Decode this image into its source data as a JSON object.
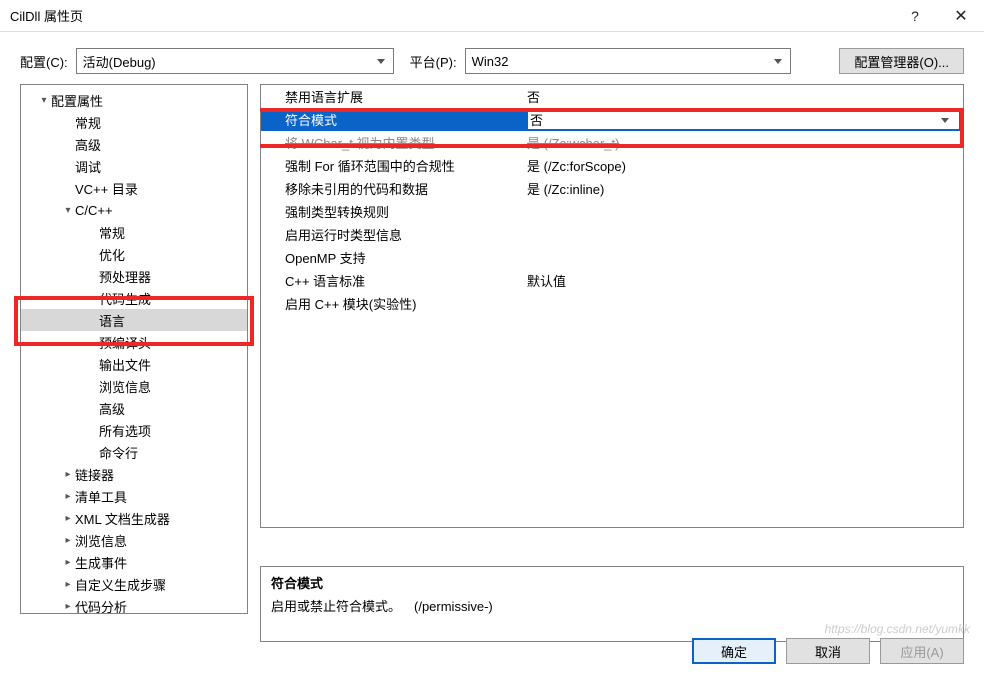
{
  "window": {
    "title": "CilDll 属性页",
    "help": "?",
    "close": "✕"
  },
  "toolbar": {
    "cfg_label": "配置(C):",
    "cfg_value": "活动(Debug)",
    "plat_label": "平台(P):",
    "plat_value": "Win32",
    "mgr": "配置管理器(O)..."
  },
  "tree": [
    {
      "lvl": 1,
      "exp": "▾",
      "label": "配置属性"
    },
    {
      "lvl": 2,
      "exp": "",
      "label": "常规"
    },
    {
      "lvl": 2,
      "exp": "",
      "label": "高级"
    },
    {
      "lvl": 2,
      "exp": "",
      "label": "调试"
    },
    {
      "lvl": 2,
      "exp": "",
      "label": "VC++ 目录"
    },
    {
      "lvl": 2,
      "exp": "▾",
      "label": "C/C++"
    },
    {
      "lvl": 3,
      "exp": "",
      "label": "常规"
    },
    {
      "lvl": 3,
      "exp": "",
      "label": "优化"
    },
    {
      "lvl": 3,
      "exp": "",
      "label": "预处理器"
    },
    {
      "lvl": 3,
      "exp": "",
      "label": "代码生成"
    },
    {
      "lvl": 3,
      "exp": "",
      "label": "语言",
      "sel": true
    },
    {
      "lvl": 3,
      "exp": "",
      "label": "预编译头"
    },
    {
      "lvl": 3,
      "exp": "",
      "label": "输出文件"
    },
    {
      "lvl": 3,
      "exp": "",
      "label": "浏览信息"
    },
    {
      "lvl": 3,
      "exp": "",
      "label": "高级"
    },
    {
      "lvl": 3,
      "exp": "",
      "label": "所有选项"
    },
    {
      "lvl": 3,
      "exp": "",
      "label": "命令行"
    },
    {
      "lvl": 2,
      "exp": "▸",
      "label": "链接器"
    },
    {
      "lvl": 2,
      "exp": "▸",
      "label": "清单工具"
    },
    {
      "lvl": 2,
      "exp": "▸",
      "label": "XML 文档生成器"
    },
    {
      "lvl": 2,
      "exp": "▸",
      "label": "浏览信息"
    },
    {
      "lvl": 2,
      "exp": "▸",
      "label": "生成事件"
    },
    {
      "lvl": 2,
      "exp": "▸",
      "label": "自定义生成步骤"
    },
    {
      "lvl": 2,
      "exp": "▸",
      "label": "代码分析"
    }
  ],
  "grid": [
    {
      "label": "禁用语言扩展",
      "value": "否"
    },
    {
      "label": "符合模式",
      "value": "否",
      "sel": true
    },
    {
      "label": "将 WChar_t 视为内置类型",
      "value": "是 (/Zc:wchar_t)",
      "struck": true
    },
    {
      "label": "强制 For 循环范围中的合规性",
      "value": "是 (/Zc:forScope)"
    },
    {
      "label": "移除未引用的代码和数据",
      "value": "是 (/Zc:inline)"
    },
    {
      "label": "强制类型转换规则",
      "value": ""
    },
    {
      "label": "启用运行时类型信息",
      "value": ""
    },
    {
      "label": "OpenMP 支持",
      "value": ""
    },
    {
      "label": "C++ 语言标准",
      "value": "默认值"
    },
    {
      "label": "启用 C++ 模块(实验性)",
      "value": ""
    }
  ],
  "desc": {
    "title": "符合模式",
    "body": "启用或禁止符合模式。 (/permissive-)"
  },
  "footer": {
    "ok": "确定",
    "cancel": "取消",
    "apply": "应用(A)"
  },
  "watermark": "https://blog.csdn.net/yumkk"
}
